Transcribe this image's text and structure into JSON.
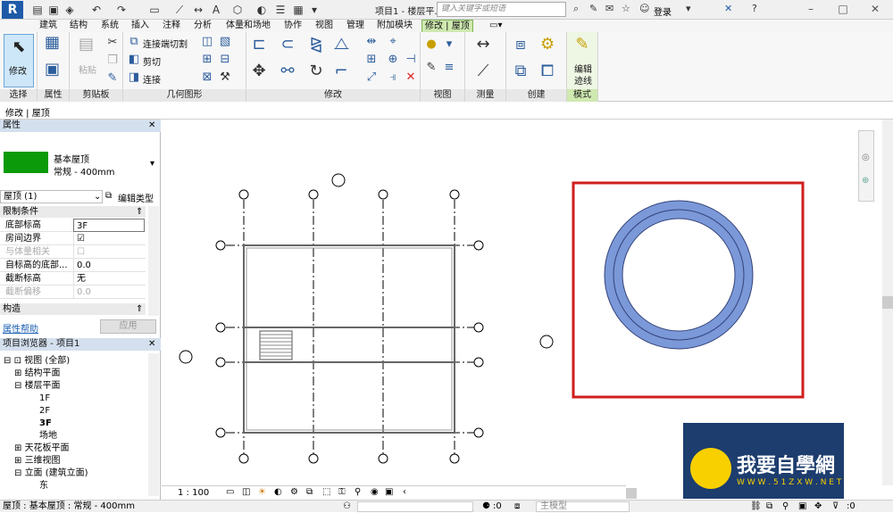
{
  "title_bar": {
    "title": "项目1 - 楼层平...",
    "search_placeholder": "键入关键字或短语",
    "login": "登录"
  },
  "menu_tabs": [
    "建筑",
    "结构",
    "系统",
    "插入",
    "注释",
    "分析",
    "体量和场地",
    "协作",
    "视图",
    "管理",
    "附加模块",
    "修改 | 屋顶"
  ],
  "ribbon": {
    "modify_label": "修改",
    "paste_label": "粘贴",
    "join_cut": "连接端切割",
    "cut": "剪切",
    "join": "连接",
    "edit_footprint_1": "编辑",
    "edit_footprint_2": "迹线",
    "panels": {
      "select": "选择",
      "properties": "属性",
      "clipboard": "剪贴板",
      "geometry": "几何图形",
      "modify": "修改",
      "view": "视图",
      "measure": "测量",
      "create": "创建",
      "mode": "模式"
    }
  },
  "context_label": "修改 | 屋顶",
  "properties": {
    "header": "属性",
    "type_name": "基本屋顶",
    "type_sub": "常规 - 400mm",
    "instance_selector": "屋顶 (1)",
    "edit_type": "编辑类型",
    "constraints_header": "限制条件",
    "rows": [
      {
        "key": "底部标高",
        "value": "3F"
      },
      {
        "key": "房间边界",
        "value": "☑"
      },
      {
        "key": "与体量相关",
        "value": "☐"
      },
      {
        "key": "自标高的底部...",
        "value": "0.0"
      },
      {
        "key": "截断标高",
        "value": "无"
      },
      {
        "key": "截断偏移",
        "value": "0.0"
      }
    ],
    "construction_header": "构造",
    "help_link": "属性帮助",
    "apply": "应用"
  },
  "project_browser": {
    "header": "项目浏览器 - 项目1",
    "items": [
      {
        "label": "视图 (全部)"
      },
      {
        "label": "结构平面"
      },
      {
        "label": "楼层平面"
      },
      {
        "label": "1F"
      },
      {
        "label": "2F"
      },
      {
        "label": "3F"
      },
      {
        "label": "场地"
      },
      {
        "label": "天花板平面"
      },
      {
        "label": "三维视图"
      },
      {
        "label": "立面 (建筑立面)"
      },
      {
        "label": "东"
      }
    ]
  },
  "view_bar": {
    "scale": "1 : 100"
  },
  "status_bar": {
    "text": "屋顶 : 基本屋顶 : 常规 - 400mm",
    "count": ":0",
    "model": "主模型"
  },
  "watermark": {
    "text": "我要自學網",
    "url": "W W W . 5 1 Z X W . N E T"
  },
  "colors": {
    "accent_green": "#cfe9b0",
    "ring_fill": "#7b98d8",
    "highlight_box": "#d01e1e",
    "roof_swatch": "#0a9a0a"
  }
}
